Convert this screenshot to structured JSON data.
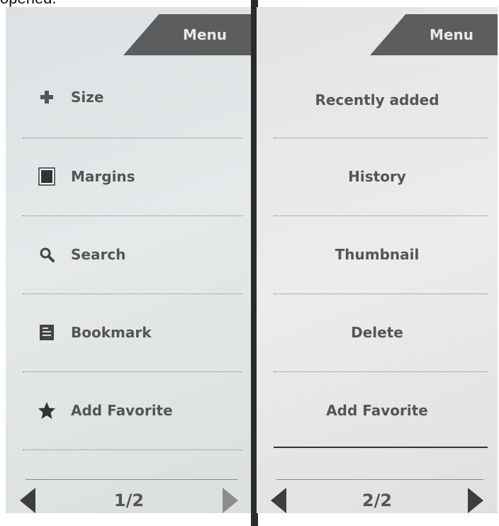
{
  "caption": "opened.",
  "left_panel": {
    "menu_label": "Menu",
    "items": [
      {
        "label": "Size",
        "icon": "plus-icon"
      },
      {
        "label": "Margins",
        "icon": "margins-icon"
      },
      {
        "label": "Search",
        "icon": "search-icon"
      },
      {
        "label": "Bookmark",
        "icon": "bookmark-icon"
      },
      {
        "label": "Add Favorite",
        "icon": "star-icon"
      }
    ],
    "page_indicator": "1/2"
  },
  "right_panel": {
    "menu_label": "Menu",
    "items": [
      {
        "label": "Recently added"
      },
      {
        "label": "History"
      },
      {
        "label": "Thumbnail"
      },
      {
        "label": "Delete"
      },
      {
        "label": "Add Favorite"
      }
    ],
    "page_indicator": "2/2"
  },
  "colors": {
    "menu_tab": "#5b5d5f",
    "label_text": "#555555",
    "arrow": "#3d3d3d"
  }
}
